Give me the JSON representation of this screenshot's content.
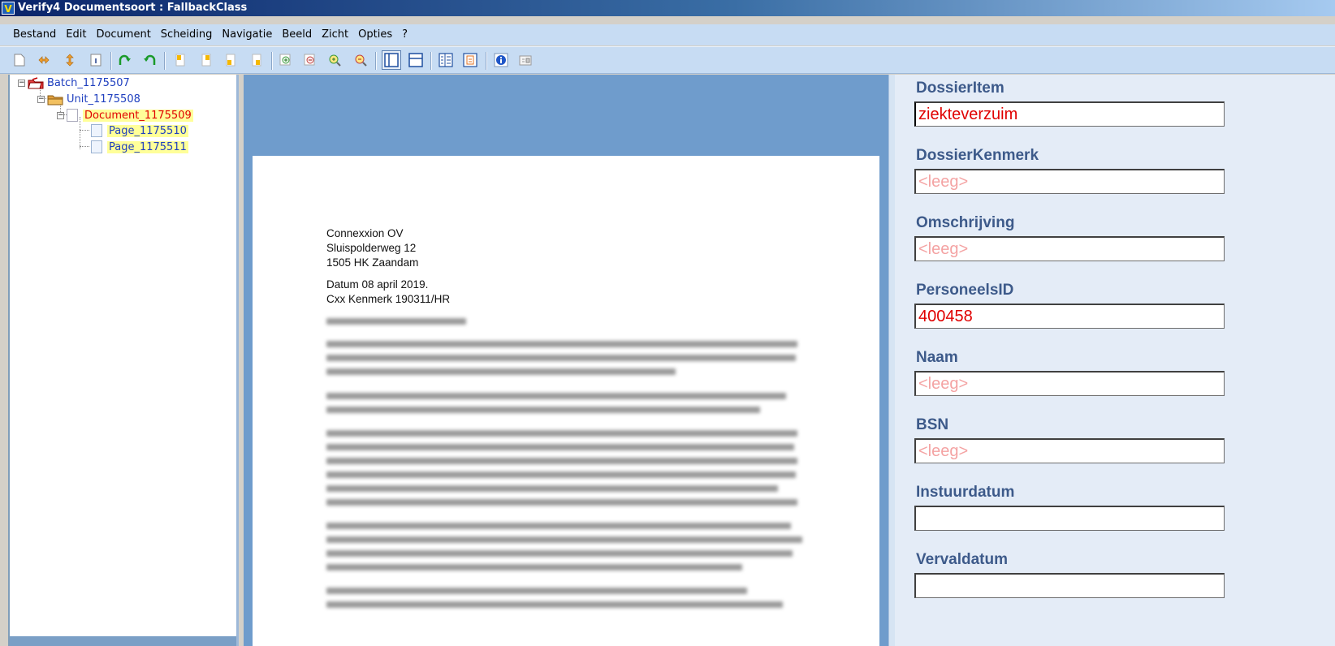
{
  "window": {
    "title": "Verify4 Documentsoort : FallbackClass",
    "icon_text": "V"
  },
  "menu": [
    "Bestand",
    "Edit",
    "Document",
    "Scheiding",
    "Navigatie",
    "Beeld",
    "Zicht",
    "Opties",
    "?"
  ],
  "tree": {
    "batch": "Batch_1175507",
    "unit": "Unit_1175508",
    "document": "Document_1175509",
    "pages": [
      "Page_1175510",
      "Page_1175511"
    ]
  },
  "document": {
    "sender_name": "Connexxion OV",
    "sender_street": "Sluispolderweg 12",
    "sender_city": "1505 HK Zaandam",
    "date_line": "Datum 08 april 2019.",
    "reference_line": "Cxx Kenmerk 190311/HR"
  },
  "fields": [
    {
      "label": "DossierItem",
      "value": "ziekteverzuim",
      "placeholder": ""
    },
    {
      "label": "DossierKenmerk",
      "value": "",
      "placeholder": "<leeg>"
    },
    {
      "label": "Omschrijving",
      "value": "",
      "placeholder": "<leeg>"
    },
    {
      "label": "PersoneelsID",
      "value": "400458",
      "placeholder": ""
    },
    {
      "label": "Naam",
      "value": "",
      "placeholder": "<leeg>"
    },
    {
      "label": "BSN",
      "value": "",
      "placeholder": "<leeg>"
    },
    {
      "label": "Instuurdatum",
      "value": "",
      "placeholder": ""
    },
    {
      "label": "Vervaldatum",
      "value": "",
      "placeholder": ""
    }
  ],
  "colors": {
    "title_gradient_start": "#0a246a",
    "menu_background": "#c7dcf3",
    "viewer_background": "#6f9ccc",
    "field_value": "#e00000",
    "field_placeholder": "#f4a3a3",
    "field_label": "#3d5a8a"
  },
  "toolbar_icons": [
    "new-page-icon",
    "swap-horizontal-icon",
    "swap-vertical-icon",
    "info-page-icon",
    "rotate-left-icon",
    "rotate-right-icon",
    "page-yellow-1-icon",
    "page-yellow-2-icon",
    "page-yellow-3-icon",
    "page-yellow-4-icon",
    "zoom-in-icon",
    "zoom-out-icon",
    "zoom-fit-in-icon",
    "zoom-fit-out-icon",
    "layout-vertical-split-icon",
    "layout-horizontal-split-icon",
    "list-view-icon",
    "thumbnail-view-icon",
    "info-icon",
    "properties-icon"
  ]
}
